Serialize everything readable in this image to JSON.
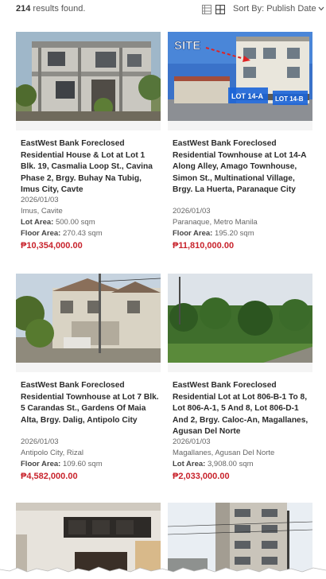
{
  "results": {
    "count": "214",
    "suffix": " results found."
  },
  "sort": {
    "label": "Sort By: ",
    "value": "Publish Date"
  },
  "listings": [
    {
      "title": "EastWest Bank Foreclosed Residential House & Lot at Lot 1 Blk. 19, Casmalia Loop St., Cavina Phase 2, Brgy. Buhay Na Tubig, Imus City, Cavte",
      "date": "2026/01/03",
      "location": "Imus, Cavite",
      "lot_label": "Lot Area: ",
      "lot_value": "500.00 sqm",
      "floor_label": "Floor Area: ",
      "floor_value": "270.43 sqm",
      "price": "₱10,354,000.00"
    },
    {
      "title": "EastWest Bank Foreclosed Residential Townhouse at Lot 14-A Along Alley, Amago Townhouse, Simon St., Multinational Village, Brgy. La Huerta, Paranaque City",
      "date": "2026/01/03",
      "location": "Paranaque, Metro Manila",
      "floor_label": "Floor Area: ",
      "floor_value": "195.20 sqm",
      "price": "₱11,810,000.00",
      "photo_labels": {
        "site": "SITE",
        "lot_a": "LOT 14-A",
        "lot_b": "LOT 14-B"
      }
    },
    {
      "title": "EastWest Bank Foreclosed Residential Townhouse at Lot 7 Blk. 5 Carandas St., Gardens Of Maia Alta, Brgy. Dalig, Antipolo City",
      "date": "2026/01/03",
      "location": "Antipolo City, Rizal",
      "floor_label": "Floor Area: ",
      "floor_value": "109.60 sqm",
      "price": "₱4,582,000.00"
    },
    {
      "title": "EastWest Bank Foreclosed Residential Lot at Lot 806-B-1 To 8, Lot 806-A-1, 5 And 8, Lot 806-D-1 And 2, Brgy. Caloc-An, Magallanes, Agusan Del Norte",
      "date": "2026/01/03",
      "location": "Magallanes, Agusan Del Norte",
      "lot_label": "Lot Area: ",
      "lot_value": "3,908.00 sqm",
      "price": "₱2,033,000.00"
    }
  ],
  "icons": {
    "list_view": "list-view-icon",
    "grid_view": "grid-view-icon",
    "sort_chevron": "chevron-down-icon"
  },
  "colors": {
    "price": "#c8232c",
    "active_icon": "#444444",
    "inactive_icon": "#888888"
  }
}
